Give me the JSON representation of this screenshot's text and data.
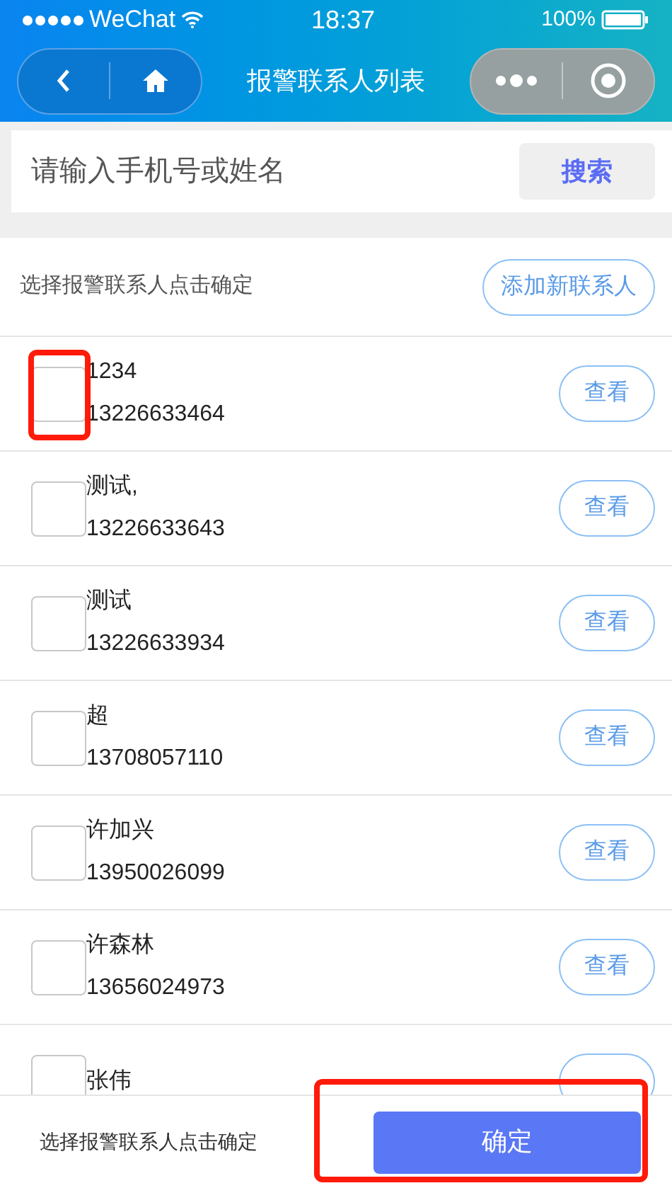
{
  "status_bar": {
    "carrier": "WeChat",
    "time": "18:37",
    "battery": "100%"
  },
  "nav": {
    "title": "报警联系人列表"
  },
  "search": {
    "placeholder": "请输入手机号或姓名",
    "button": "搜索"
  },
  "list_header": {
    "hint": "选择报警联系人点击确定",
    "add_button": "添加新联系人"
  },
  "contacts": [
    {
      "name": "1234",
      "phone": "13226633464",
      "checked": false,
      "button": "查看"
    },
    {
      "name": "测试,",
      "phone": "13226633643",
      "checked": false,
      "button": "查看"
    },
    {
      "name": "测试",
      "phone": "13226633934",
      "checked": false,
      "button": "查看"
    },
    {
      "name": "超",
      "phone": "13708057110",
      "checked": false,
      "button": "查看"
    },
    {
      "name": "许加兴",
      "phone": "13950026099",
      "checked": false,
      "button": "查看"
    },
    {
      "name": "许森林",
      "phone": "13656024973",
      "checked": false,
      "button": "查看"
    },
    {
      "name": "张伟",
      "checked": false
    }
  ],
  "footer": {
    "hint": "选择报警联系人点击确定",
    "confirm": "确定"
  }
}
